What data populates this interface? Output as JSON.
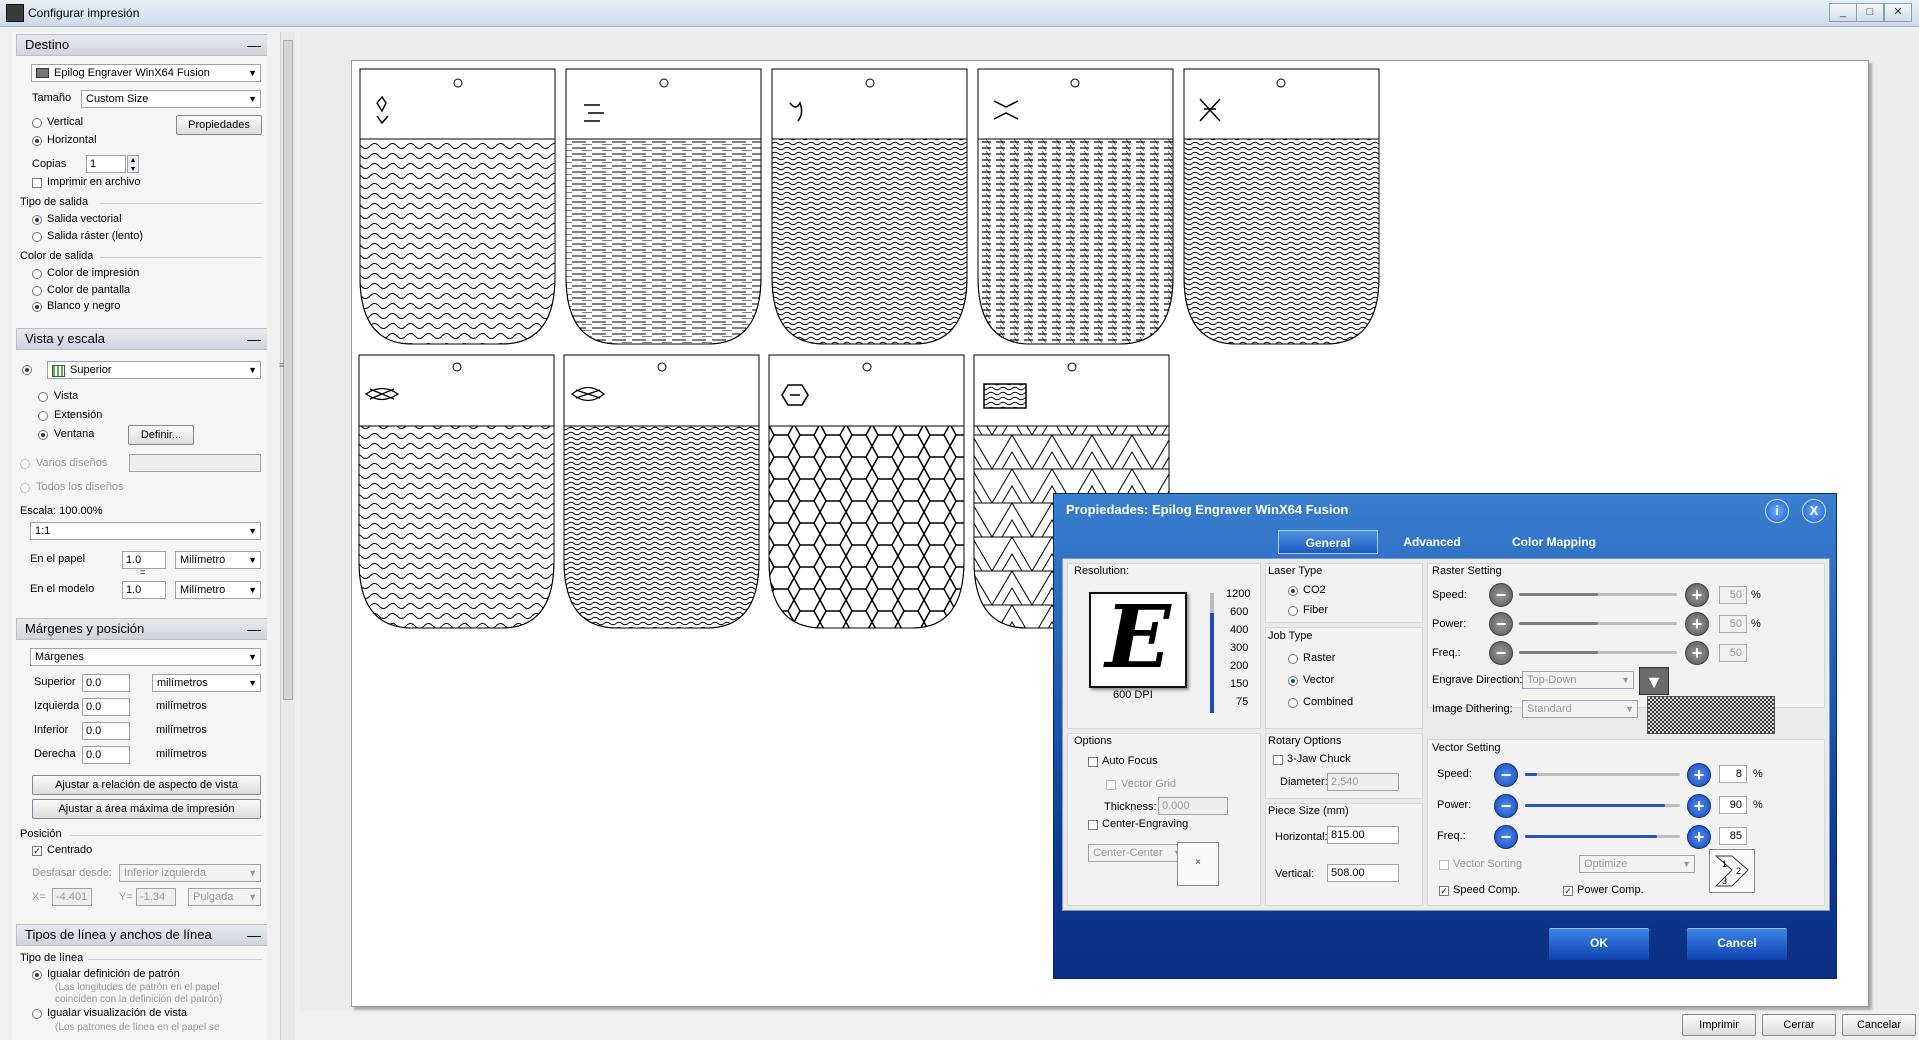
{
  "window": {
    "title": "Configurar impresión",
    "btn_min": "_",
    "btn_max": "□",
    "btn_close": "✕"
  },
  "destino": {
    "header": "Destino",
    "printer": "Epilog Engraver WinX64 Fusion",
    "size_label": "Tamaño",
    "size_value": "Custom Size",
    "vertical": "Vertical",
    "horizontal": "Horizontal",
    "properties_btn": "Propiedades",
    "copies_label": "Copias",
    "copies_value": "1",
    "print_to_file": "Imprimir en archivo",
    "output_type_label": "Tipo de salida",
    "vector_output": "Salida vectorial",
    "raster_output": "Salida ráster (lento)",
    "output_color_label": "Color de salida",
    "print_color": "Color de impresión",
    "screen_color": "Color de pantalla",
    "black_white": "Blanco y negro"
  },
  "vista": {
    "header": "Vista y escala",
    "view_value": "Superior",
    "view_opt": "Vista",
    "extent_opt": "Extensión",
    "window_opt": "Ventana",
    "define_btn": "Definir...",
    "multi_layouts": "Varios diseños",
    "all_layouts": "Todos los diseños",
    "scale_label": "Escala: 100.00%",
    "scale_value": "1:1",
    "paper_label": "En el papel",
    "paper_value": "1.0",
    "paper_unit": "Milímetro",
    "equals": "=",
    "model_label": "En el modelo",
    "model_value": "1.0",
    "model_unit": "Milímetro"
  },
  "margenes": {
    "header": "Márgenes y posición",
    "mode_value": "Márgenes",
    "top_label": "Superior",
    "top_value": "0.0",
    "top_unit": "milímetros",
    "left_label": "Izquierda",
    "left_value": "0.0",
    "left_unit": "milímetros",
    "bottom_label": "Inferior",
    "bottom_value": "0.0",
    "bottom_unit": "milímetros",
    "right_label": "Derecha",
    "right_value": "0.0",
    "right_unit": "milímetros",
    "fit_aspect_btn": "Ajustar a relación de aspecto de vista",
    "fit_max_btn": "Ajustar a área máxima de impresión",
    "position_label": "Posición",
    "centered": "Centrado",
    "offset_label": "Desfasar desde:",
    "offset_value": "Inferior izquierda",
    "x_label": "X=",
    "x_value": "-4.401",
    "y_label": "Y=",
    "y_value": "-1.34",
    "unit_value": "Pulgada"
  },
  "lineas": {
    "header": "Tipos de línea y anchos de línea",
    "type_label": "Tipo de línea",
    "match_pattern": "Igualar definición de patrón",
    "match_pattern_note1": "(Las longitudes de patrón en el papel",
    "match_pattern_note2": "coinciden con la definición del patrón)",
    "match_view": "Igualar visualización de vista",
    "match_view_note": "(Los patrones de línea en el papel se"
  },
  "dialog": {
    "title": "Propiedades: Epilog Engraver WinX64 Fusion",
    "help": "i",
    "close": "X",
    "tabs": [
      "General",
      "Advanced",
      "Color Mapping"
    ],
    "resolution_label": "Resolution:",
    "resolution_letter": "E",
    "resolution_dpi": "600 DPI",
    "dpi_ticks": [
      "1200",
      "600",
      "400",
      "300",
      "200",
      "150",
      "75"
    ],
    "laser_type_label": "Laser Type",
    "co2": "CO2",
    "fiber": "Fiber",
    "job_type_label": "Job Type",
    "raster": "Raster",
    "vector": "Vector",
    "combined": "Combined",
    "options_label": "Options",
    "auto_focus": "Auto Focus",
    "vector_grid": "Vector Grid",
    "thickness_label": "Thickness:",
    "thickness_value": "0.000",
    "center_engraving": "Center-Engraving",
    "center_value": "Center-Center",
    "rotary_label": "Rotary Options",
    "three_jaw": "3-Jaw Chuck",
    "diameter_label": "Diameter:",
    "diameter_value": "2.540",
    "piece_size_label": "Piece Size (mm)",
    "horizontal_label": "Horizontal:",
    "horizontal_value": "815.00",
    "vertical_label": "Vertical:",
    "vertical_value": "508.00",
    "raster_setting_label": "Raster Setting",
    "r_speed_label": "Speed:",
    "r_speed_value": "50",
    "r_speed_level": 0.5,
    "r_power_label": "Power:",
    "r_power_value": "50",
    "r_power_level": 0.5,
    "r_freq_label": "Freq.:",
    "r_freq_value": "50",
    "r_freq_level": 0.5,
    "engrave_dir_label": "Engrave Direction:",
    "engrave_dir_value": "Top-Down",
    "dithering_label": "Image Dithering:",
    "dithering_value": "Standard",
    "vector_setting_label": "Vector Setting",
    "v_speed_label": "Speed:",
    "v_speed_value": "8",
    "v_speed_level": 0.08,
    "v_power_label": "Power:",
    "v_power_value": "90",
    "v_power_level": 0.9,
    "v_freq_label": "Freq.:",
    "v_freq_value": "85",
    "v_freq_level": 0.85,
    "percent": "%",
    "vector_sorting": "Vector Sorting",
    "sorting_value": "Optimize",
    "speed_comp": "Speed Comp.",
    "power_comp": "Power Comp.",
    "ok": "OK",
    "cancel": "Cancel"
  },
  "footer": {
    "print_btn": "Imprimir",
    "close_btn": "Cerrar",
    "cancel_btn": "Cancelar"
  }
}
